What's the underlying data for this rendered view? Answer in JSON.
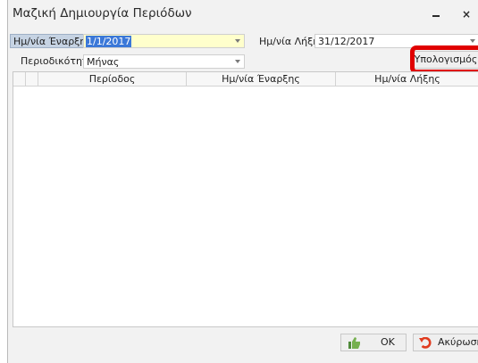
{
  "window": {
    "title": "Μαζική Δημιουργία Περιόδων",
    "minimize_glyph": "",
    "close_glyph": "×"
  },
  "form": {
    "start_date_label": "Ημ/νία Έναρξης",
    "start_date_value": "1/1/2017",
    "end_date_label": "Ημ/νία Λήξης",
    "end_date_value": "31/12/2017",
    "frequency_label": "Περιοδικότητα",
    "frequency_value": "Μήνας",
    "calculate_label": "Υπολογισμός"
  },
  "grid": {
    "columns": [
      "Περίοδος",
      "Ημ/νία Έναρξης",
      "Ημ/νία Λήξης"
    ],
    "rows": []
  },
  "footer": {
    "ok_label": "OK",
    "cancel_label": "Ακύρωση"
  },
  "colors": {
    "highlight": "#e00000",
    "selection": "#3b78d8",
    "start_field": "#ffffcc"
  },
  "icons": {
    "ok": "thumbs-up-icon",
    "cancel": "undo-arrow-icon"
  }
}
